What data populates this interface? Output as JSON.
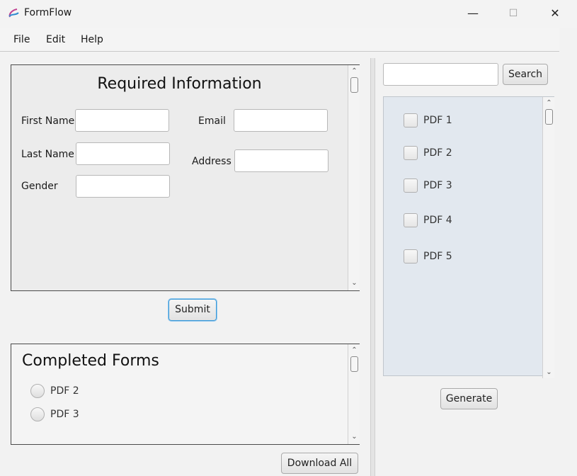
{
  "window": {
    "title": "FormFlow",
    "minimize": "—",
    "maximize": "☐",
    "close": "✕"
  },
  "menu": [
    "File",
    "Edit",
    "Help"
  ],
  "required": {
    "heading": "Required Information",
    "first_name_label": "First Name",
    "last_name_label": "Last Name",
    "gender_label": "Gender",
    "email_label": "Email",
    "address_label": "Address",
    "first_name_value": "",
    "last_name_value": "",
    "gender_value": "",
    "email_value": "",
    "address_value": ""
  },
  "submit_label": "Submit",
  "completed": {
    "heading": "Completed Forms",
    "items": [
      "PDF 2",
      "PDF 3"
    ]
  },
  "download_label": "Download All",
  "search": {
    "value": "",
    "button_label": "Search"
  },
  "pdf_list": [
    "PDF 1",
    "PDF 2",
    "PDF 3",
    "PDF 4",
    "PDF 5"
  ],
  "generate_label": "Generate",
  "scroll_arrows": {
    "up": "⌃",
    "down": "⌄"
  },
  "colors": {
    "list_bg": "#e2e8ef",
    "panel_bg": "#ececec",
    "focus": "#3c9ad8"
  }
}
